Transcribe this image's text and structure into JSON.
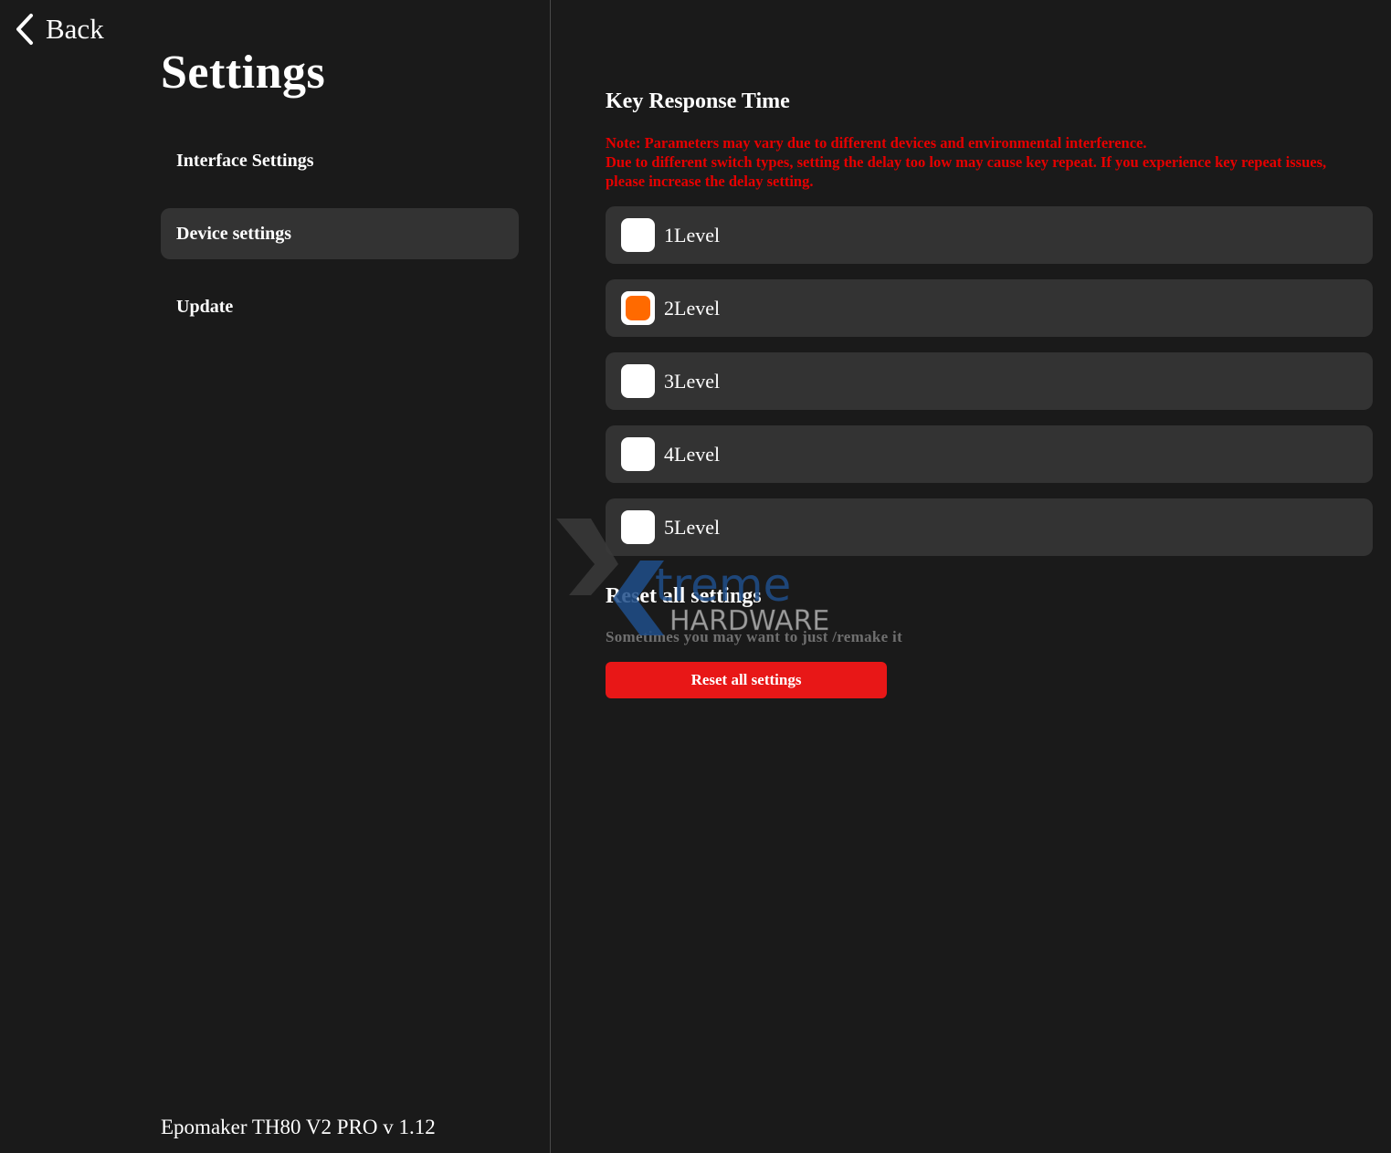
{
  "header": {
    "back_label": "Back",
    "back_icon": "chevron-left-icon"
  },
  "sidebar": {
    "title": "Settings",
    "items": [
      {
        "label": "Interface Settings",
        "active": false
      },
      {
        "label": "Device settings",
        "active": true
      },
      {
        "label": "Update",
        "active": false
      }
    ],
    "version": "Epomaker TH80 V2 PRO v 1.12"
  },
  "key_response": {
    "title": "Key Response Time",
    "note_line1": "Note: Parameters may vary due to different devices and environmental interference.",
    "note_line2": "Due to different switch types, setting the delay too low may cause key repeat. If you experience key repeat issues, please increase the delay setting.",
    "options": [
      {
        "label": "1Level",
        "checked": false
      },
      {
        "label": "2Level",
        "checked": true
      },
      {
        "label": "3Level",
        "checked": false
      },
      {
        "label": "4Level",
        "checked": false
      },
      {
        "label": "5Level",
        "checked": false
      }
    ],
    "selected": "2Level"
  },
  "reset": {
    "title": "Reset all settings",
    "description": "Sometimes you may want to just /remake it",
    "button_label": "Reset all settings"
  },
  "watermark": {
    "line1": "treme",
    "line2": "HARDWARE"
  },
  "colors": {
    "background": "#1a1a1a",
    "panel": "#333333",
    "accent_checked": "#ff6a00",
    "note_red": "#e50000",
    "button_red": "#e81717"
  }
}
